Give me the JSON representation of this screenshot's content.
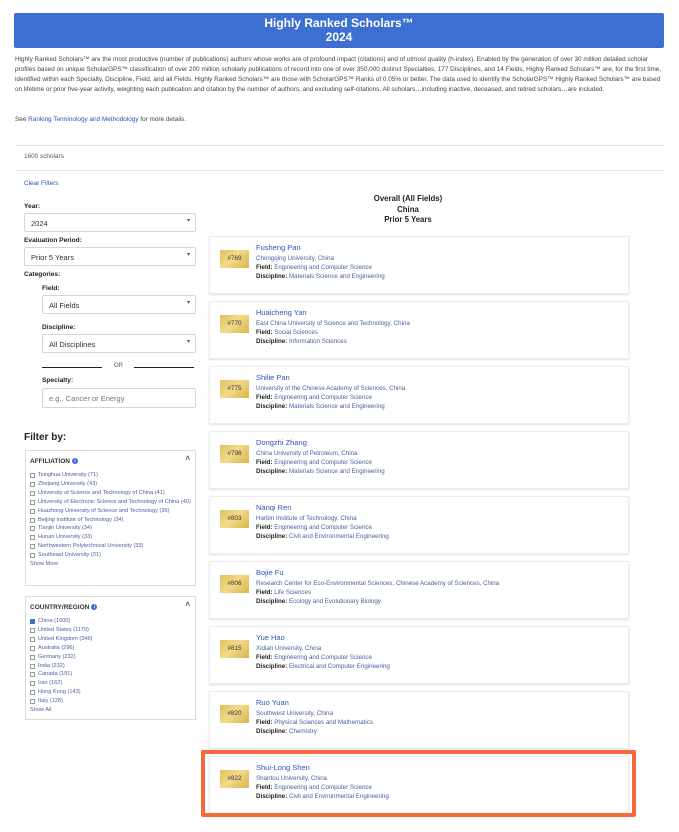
{
  "header": {
    "title": "Highly Ranked Scholars™",
    "year": "2024"
  },
  "intro": {
    "text": "Highly Ranked Scholars™ are the most productive (number of publications) authors whose works are of profound impact (citations) and of utmost quality (h-index). Enabled by the generation of over 30 million detailed scholar profiles based on unique ScholarGPS™ classification of over 200 million scholarly publications of record into one of over 350,000 distinct Specialties, 177 Disciplines, and 14 Fields, Highly Ranked Scholars™ are, for the first time, identified within each Specialty, Discipline, Field, and all Fields. Highly Ranked Scholars™ are those with ScholarGPS™ Ranks of 0.05% or better. The data used to identify the ScholarGPS™ Highly Ranked Scholars™ are based on lifetime or prior five-year activity, weighting each publication and citation by the number of authors, and excluding self-citations. All scholars…including inactive, deceased, and retired scholars…are included.",
    "see_prefix": "See ",
    "see_link": "Ranking Terminology and Methodology",
    "see_suffix": " for more details."
  },
  "result_count": "1600 scholars",
  "filters": {
    "clear": "Clear Filters",
    "year_label": "Year:",
    "year_value": "2024",
    "period_label": "Evaluation Period:",
    "period_value": "Prior 5 Years",
    "categories_label": "Categories:",
    "field_label": "Field:",
    "field_value": "All Fields",
    "discipline_label": "Discipline:",
    "discipline_value": "All Disciplines",
    "or_text": "OR",
    "specialty_label": "Specialty:",
    "specialty_placeholder": "e.g., Cancer or Energy"
  },
  "filter_by": {
    "title": "Filter by:",
    "affiliation": {
      "title": "AFFILIATION",
      "options": [
        "Tsinghua University (71)",
        "Zhejiang University (43)",
        "University of Science and Technology of China (41)",
        "University of Electronic Science and Technology of China (40)",
        "Huazhong University of Science and Technology (36)",
        "Beijing Institute of Technology (34)",
        "Tianjin University (34)",
        "Hunan University (33)",
        "Northwestern Polytechnical University (33)",
        "Southeast University (31)"
      ],
      "show_more": "Show More"
    },
    "country": {
      "title": "COUNTRY/REGION",
      "options": [
        "China (1600)",
        "United States (1179)",
        "United Kingdom (346)",
        "Australia (296)",
        "Germany (232)",
        "India (232)",
        "Canada (191)",
        "Iran (162)",
        "Hong Kong (143)",
        "Italy (128)"
      ],
      "show_all": "Show All"
    }
  },
  "results": {
    "heading_line1": "Overall (All Fields)",
    "heading_line2": "China",
    "heading_line3": "Prior 5 Years",
    "field_label": "Field:",
    "discipline_label": "Discipline:",
    "scholars": [
      {
        "rank": "#769",
        "name": "Fusheng Pan",
        "affiliation": "Chongqing University, China",
        "field": "Engineering and Computer Science",
        "discipline": "Materials Science and Engineering"
      },
      {
        "rank": "#770",
        "name": "Huaicheng Yan",
        "affiliation": "East China University of Science and Technology, China",
        "field": "Social Sciences",
        "discipline": "Information Sciences"
      },
      {
        "rank": "#775",
        "name": "Shilie Pan",
        "affiliation": "University of the Chinese Academy of Sciences, China",
        "field": "Engineering and Computer Science",
        "discipline": "Materials Science and Engineering"
      },
      {
        "rank": "#796",
        "name": "Dongzhi Zhang",
        "affiliation": "China University of Petroleum, China",
        "field": "Engineering and Computer Science",
        "discipline": "Materials Science and Engineering"
      },
      {
        "rank": "#803",
        "name": "Nanqi Ren",
        "affiliation": "Harbin Institute of Technology, China",
        "field": "Engineering and Computer Science",
        "discipline": "Civil and Environmental Engineering"
      },
      {
        "rank": "#806",
        "name": "Bojie Fu",
        "affiliation": "Research Center for Eco-Environmental Sciences, Chinese Academy of Sciences, China",
        "field": "Life Sciences",
        "discipline": "Ecology and Evolutionary Biology"
      },
      {
        "rank": "#815",
        "name": "Yue Hao",
        "affiliation": "Xidian University, China",
        "field": "Engineering and Computer Science",
        "discipline": "Electrical and Computer Engineering"
      },
      {
        "rank": "#820",
        "name": "Ruo Yuan",
        "affiliation": "Southwest University, China",
        "field": "Physical Sciences and Mathematics",
        "discipline": "Chemistry"
      },
      {
        "rank": "#822",
        "name": "Shui-Long Shen",
        "affiliation": "Shantou University, China",
        "field": "Engineering and Computer Science",
        "discipline": "Civil and Environmental Engineering"
      }
    ]
  },
  "colors": {
    "banner": "#3c6fd1",
    "link": "#2a55b8",
    "highlight": "#f46a3c",
    "rank_badge": "#e2c05a"
  }
}
